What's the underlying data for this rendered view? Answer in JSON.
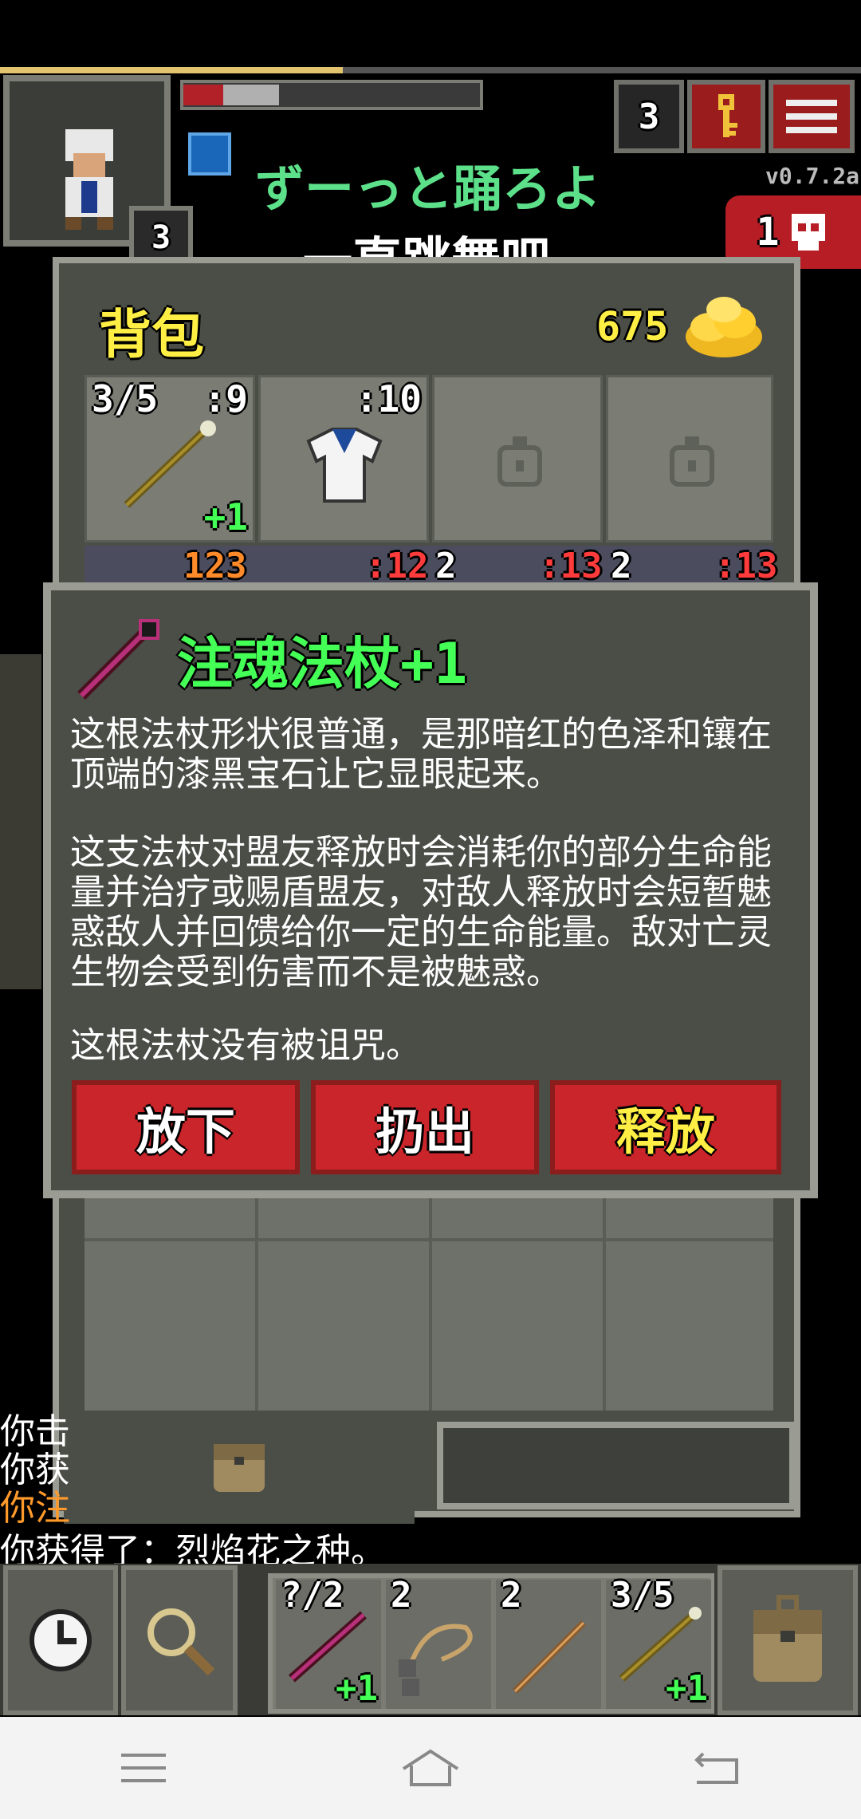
{
  "top": {
    "depth": "3",
    "version": "v0.7.2a",
    "danger_count": "1",
    "hero_level": "3"
  },
  "song": {
    "jp": "ずーっと踊ろよ",
    "cn": "一直跳舞吧"
  },
  "backpack": {
    "title": "背包",
    "gold": "675",
    "slots": [
      {
        "top_left": "3/5",
        "top_right": ":9",
        "bottom": "+1",
        "icon": "staff-icon"
      },
      {
        "top_left": "",
        "top_right": ":10",
        "bottom": "",
        "icon": "armor-icon"
      },
      {
        "icon": "empty-slot-icon"
      },
      {
        "icon": "empty-slot-icon"
      }
    ],
    "row2": [
      "123",
      ":12",
      "2",
      ":13",
      "2",
      ":13"
    ]
  },
  "item": {
    "name": "注魂法杖+1",
    "desc1": "这根法杖形状很普通，是那暗红的色泽和镶在顶端的漆黑宝石让它显眼起来。",
    "desc2": "这支法杖对盟友释放时会消耗你的部分生命能量并治疗或赐盾盟友，对敌人释放时会短暂魅惑敌人并回馈给你一定的生命能量。敌对亡灵生物会受到伤害而不是被魅惑。",
    "desc3": "这根法杖没有被诅咒。",
    "drop": "放下",
    "throw": "扔出",
    "zap": "释放"
  },
  "log": [
    "你击",
    "你获",
    "你注",
    "你获得了：烈焰花之种。"
  ],
  "quickslots": [
    {
      "top": "?/2",
      "bottom": "+1",
      "icon": "soul-staff-icon"
    },
    {
      "top": "2",
      "bottom": "",
      "icon": "bolas-icon"
    },
    {
      "top": "2",
      "bottom": "",
      "icon": "dart-icon"
    },
    {
      "top": "3/5",
      "bottom": "+1",
      "icon": "staff-icon"
    }
  ],
  "colors": {
    "accent_green": "#44ff55",
    "gold_yellow": "#ffef44",
    "button_red": "#c9252b"
  }
}
